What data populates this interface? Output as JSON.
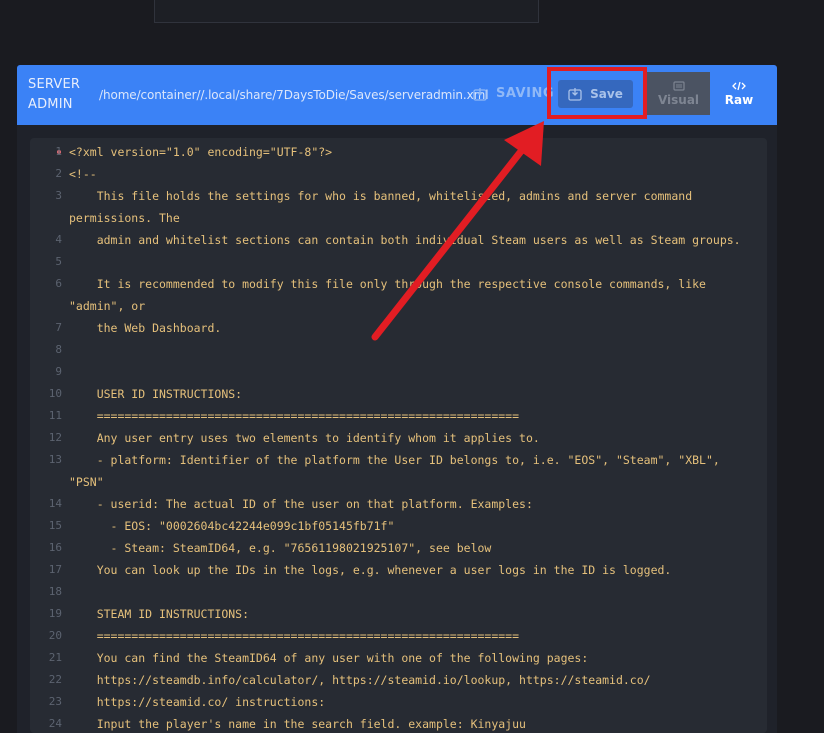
{
  "header": {
    "title_line1": "SERVER",
    "title_line2": "ADMIN",
    "path": "/home/container//.local/share/7DaysToDie/Saves/serveradmin.xml",
    "saving_label": "SAVING .",
    "save_label": "Save",
    "tabs": {
      "visual": "Visual",
      "raw": "Raw"
    }
  },
  "code": {
    "lines": [
      {
        "n": "1",
        "text": "<?xml version=\"1.0\" encoding=\"UTF-8\"?>"
      },
      {
        "n": "2",
        "text": "<!--"
      },
      {
        "n": "3",
        "text": "    This file holds the settings for who is banned, whitelisted, admins and server command"
      },
      {
        "n": "",
        "text": "permissions. The"
      },
      {
        "n": "4",
        "text": "    admin and whitelist sections can contain both individual Steam users as well as Steam groups."
      },
      {
        "n": "5",
        "text": ""
      },
      {
        "n": "6",
        "text": "    It is recommended to modify this file only through the respective console commands, like"
      },
      {
        "n": "",
        "text": "\"admin\", or"
      },
      {
        "n": "7",
        "text": "    the Web Dashboard."
      },
      {
        "n": "8",
        "text": ""
      },
      {
        "n": "9",
        "text": ""
      },
      {
        "n": "10",
        "text": "    USER ID INSTRUCTIONS:"
      },
      {
        "n": "11",
        "text": "    ============================================================="
      },
      {
        "n": "12",
        "text": "    Any user entry uses two elements to identify whom it applies to."
      },
      {
        "n": "13",
        "text": "    - platform: Identifier of the platform the User ID belongs to, i.e. \"EOS\", \"Steam\", \"XBL\","
      },
      {
        "n": "",
        "text": "\"PSN\""
      },
      {
        "n": "14",
        "text": "    - userid: The actual ID of the user on that platform. Examples:"
      },
      {
        "n": "15",
        "text": "      - EOS: \"0002604bc42244e099c1bf05145fb71f\""
      },
      {
        "n": "16",
        "text": "      - Steam: SteamID64, e.g. \"76561198021925107\", see below"
      },
      {
        "n": "17",
        "text": "    You can look up the IDs in the logs, e.g. whenever a user logs in the ID is logged."
      },
      {
        "n": "18",
        "text": ""
      },
      {
        "n": "19",
        "text": "    STEAM ID INSTRUCTIONS:"
      },
      {
        "n": "20",
        "text": "    ============================================================="
      },
      {
        "n": "21",
        "text": "    You can find the SteamID64 of any user with one of the following pages:"
      },
      {
        "n": "22",
        "text": "    https://steamdb.info/calculator/, https://steamid.io/lookup, https://steamid.co/"
      },
      {
        "n": "23",
        "text": "    https://steamid.co/ instructions:"
      },
      {
        "n": "24",
        "text": "    Input the player's name in the search field. example: Kinyajuu"
      }
    ]
  },
  "colors": {
    "accent": "#3b82f6",
    "highlight": "#e21d23",
    "code_text": "#e5c07b"
  },
  "icons": [
    "download-icon",
    "save-icon",
    "visual-icon",
    "code-icon",
    "arrow-annotation"
  ]
}
